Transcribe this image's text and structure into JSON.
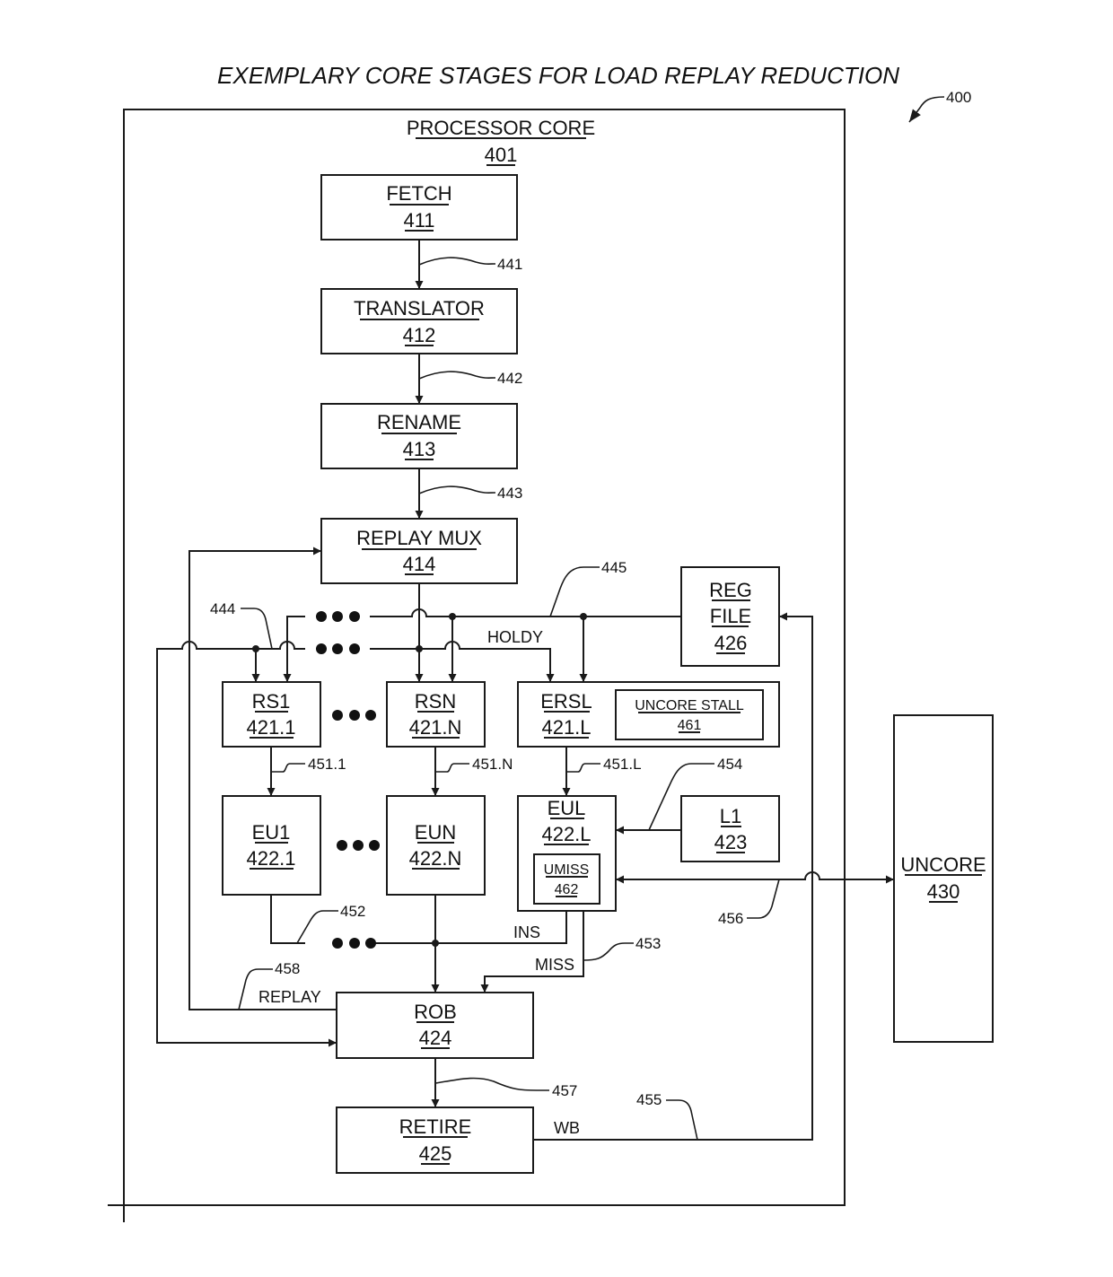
{
  "figure": {
    "title": "EXEMPLARY CORE STAGES FOR LOAD REPLAY REDUCTION",
    "figure_ref": "400"
  },
  "blocks": {
    "core": {
      "name": "PROCESSOR CORE",
      "ref": "401"
    },
    "fetch": {
      "name": "FETCH",
      "ref": "411"
    },
    "translator": {
      "name": "TRANSLATOR",
      "ref": "412"
    },
    "rename": {
      "name": "RENAME",
      "ref": "413"
    },
    "replay_mux": {
      "name": "REPLAY MUX",
      "ref": "414"
    },
    "rs1": {
      "name": "RS1",
      "ref": "421.1"
    },
    "rsn": {
      "name": "RSN",
      "ref": "421.N"
    },
    "ersl": {
      "name": "ERSL",
      "ref": "421.L"
    },
    "uncore_stall": {
      "name": "UNCORE STALL",
      "ref": "461"
    },
    "reg_file": {
      "name_line1": "REG",
      "name_line2": "FILE",
      "ref": "426"
    },
    "eu1": {
      "name": "EU1",
      "ref": "422.1"
    },
    "eun": {
      "name": "EUN",
      "ref": "422.N"
    },
    "eul": {
      "name": "EUL",
      "ref": "422.L"
    },
    "umiss": {
      "name": "UMISS",
      "ref": "462"
    },
    "l1": {
      "name": "L1",
      "ref": "423"
    },
    "rob": {
      "name": "ROB",
      "ref": "424"
    },
    "retire": {
      "name": "RETIRE",
      "ref": "425"
    },
    "uncore": {
      "name": "UNCORE",
      "ref": "430"
    }
  },
  "connections": {
    "c441": "441",
    "c442": "442",
    "c443": "443",
    "c444": "444",
    "c445": "445",
    "c451_1": "451.1",
    "c451_n": "451.N",
    "c451_l": "451.L",
    "c452": "452",
    "c453": "453",
    "c454": "454",
    "c455": "455",
    "c456": "456",
    "c457": "457",
    "c458": "458"
  },
  "signals": {
    "holdy": "HOLDY",
    "ins": "INS",
    "miss": "MISS",
    "replay": "REPLAY",
    "wb": "WB"
  }
}
